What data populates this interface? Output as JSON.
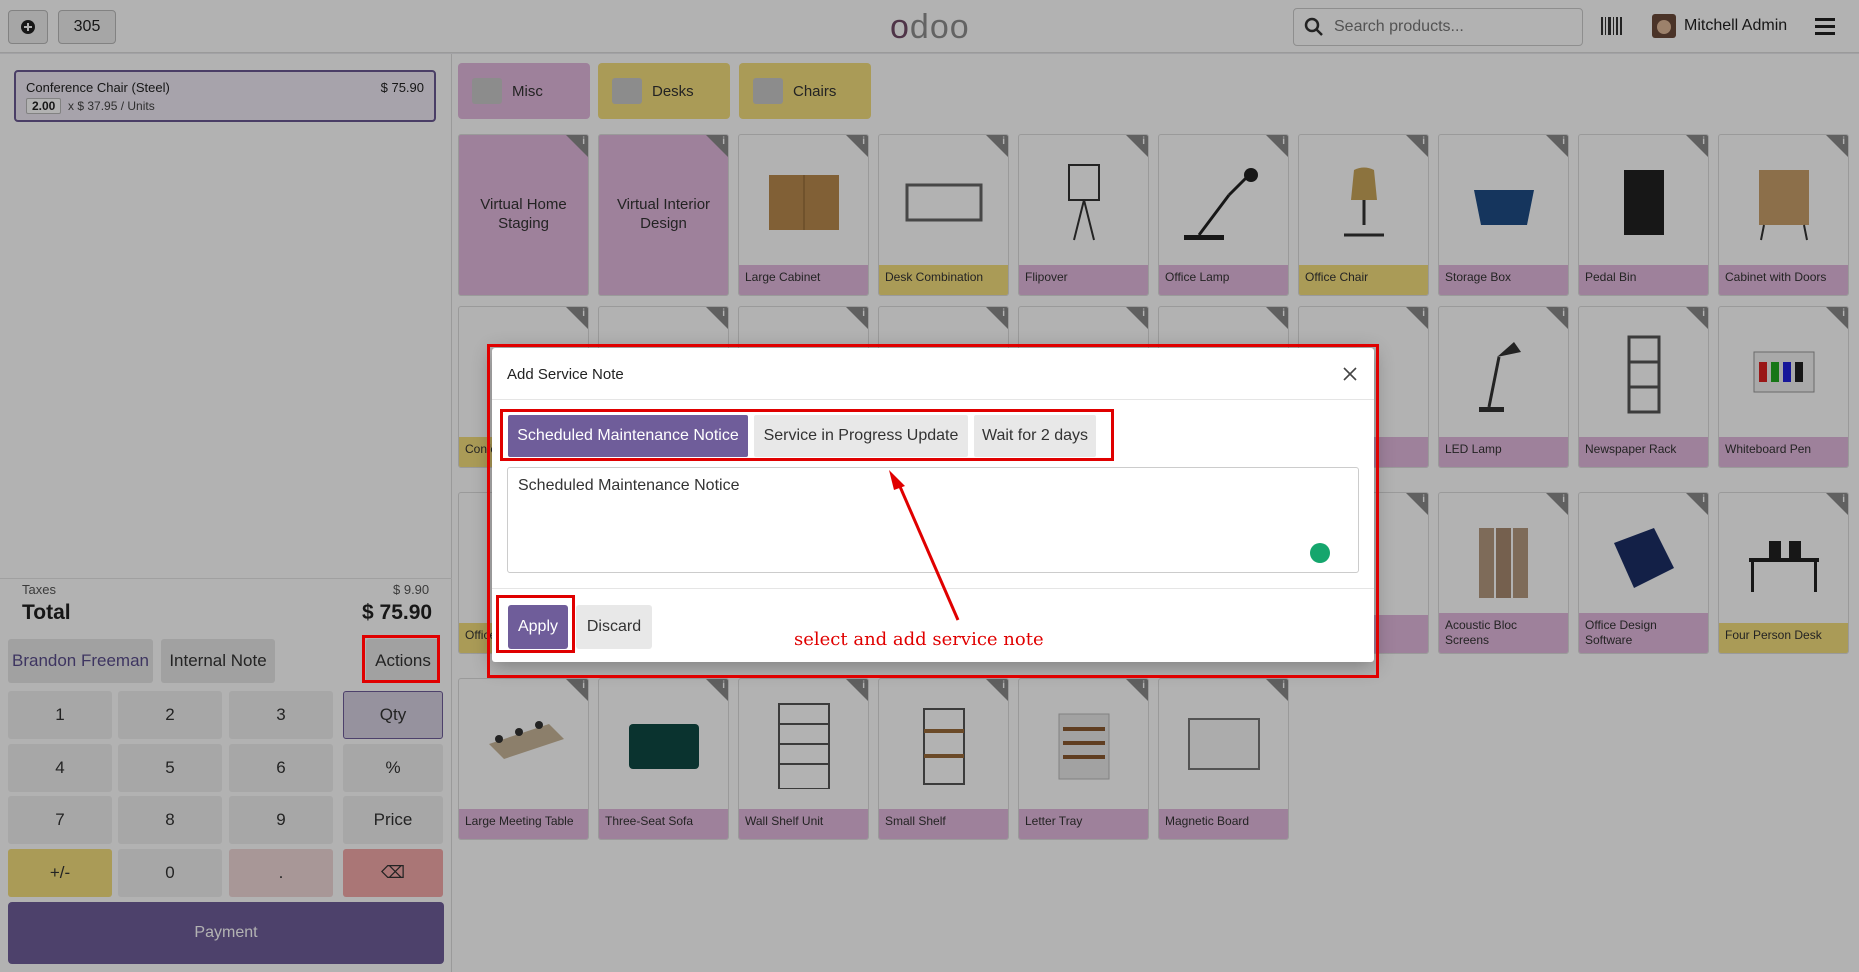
{
  "topbar": {
    "new_order_icon": "plus-circle-icon",
    "order_number": "305",
    "logo": "odoo",
    "search_placeholder": "Search products...",
    "user_name": "Mitchell Admin"
  },
  "order": {
    "line": {
      "product": "Conference Chair (Steel)",
      "price": "$ 75.90",
      "qty": "2.00",
      "unit_price": "x $ 37.95 / Units"
    },
    "taxes_label": "Taxes",
    "taxes_value": "$ 9.90",
    "total_label": "Total",
    "total_value": "$ 75.90"
  },
  "controls": {
    "customer": "Brandon Freeman",
    "internal_note": "Internal Note",
    "actions": "Actions"
  },
  "numpad": {
    "keys": [
      "1",
      "2",
      "3",
      "Qty",
      "4",
      "5",
      "6",
      "%",
      "7",
      "8",
      "9",
      "Price",
      "+/-",
      "0",
      ".",
      "⌫"
    ],
    "payment": "Payment"
  },
  "categories": [
    {
      "label": "Misc",
      "color": "#e3b9de"
    },
    {
      "label": "Desks",
      "color": "#f4de7d"
    },
    {
      "label": "Chairs",
      "color": "#f4de7d"
    }
  ],
  "products": {
    "row1": [
      "Virtual Home Staging",
      "Virtual Interior Design",
      "Large Cabinet",
      "Desk Combination",
      "Flipover",
      "Office Lamp",
      "Office Chair",
      "Storage Box",
      "Pedal Bin",
      "Cabinet with Doors"
    ],
    "row2": [
      "Conference Chair",
      "LED Lamp",
      "Newspaper Rack",
      "Whiteboard Pen"
    ],
    "row3": [
      "Office",
      "Acoustic Bloc Screens",
      "Office Design Software",
      "Four Person Desk"
    ],
    "row4": [
      "Large Meeting Table",
      "Three-Seat Sofa",
      "Wall Shelf Unit",
      "Small Shelf",
      "Letter Tray",
      "Magnetic Board"
    ]
  },
  "modal": {
    "title": "Add Service Note",
    "presets": [
      "Scheduled Maintenance Notice",
      "Service in Progress Update",
      "Wait for 2 days"
    ],
    "note_value": "Scheduled Maintenance Notice",
    "apply": "Apply",
    "discard": "Discard"
  },
  "annotation": {
    "text": "select and add service note",
    "color": "#e00000"
  },
  "colors": {
    "brand": "#714B67",
    "primary": "#6f5d9a",
    "pink": "#e3b9de",
    "yellow": "#f4de7d"
  }
}
